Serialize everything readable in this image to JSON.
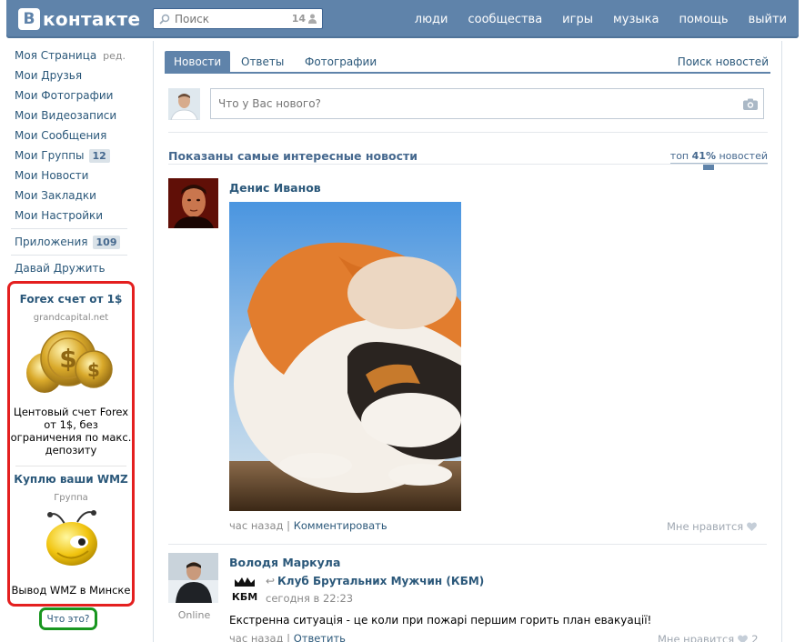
{
  "header": {
    "logo_badge": "В",
    "logo_text": "контакте",
    "search_placeholder": "Поиск",
    "search_count": "14",
    "nav": [
      "люди",
      "сообщества",
      "игры",
      "музыка",
      "помощь",
      "выйти"
    ]
  },
  "sidebar": {
    "items": [
      {
        "label": "Моя Страница",
        "extra": "ред."
      },
      {
        "label": "Мои Друзья"
      },
      {
        "label": "Мои Фотографии"
      },
      {
        "label": "Мои Видеозаписи"
      },
      {
        "label": "Мои Сообщения"
      },
      {
        "label": "Мои Группы",
        "badge": "12"
      },
      {
        "label": "Мои Новости"
      },
      {
        "label": "Мои Закладки"
      },
      {
        "label": "Мои Настройки"
      }
    ],
    "apps": {
      "label": "Приложения",
      "badge": "109"
    },
    "friends_link": "Давай Дружить"
  },
  "ads": [
    {
      "title": "Forex счет от 1$",
      "subtitle": "grandcapital.net",
      "text": "Центовый счет Forex от 1$, без ограничения по макс. депозиту"
    },
    {
      "title": "Куплю ваши WMZ",
      "subtitle": "Группа",
      "text": "Вывод WMZ в Минске"
    }
  ],
  "whatis_label": "Что это?",
  "tabs": {
    "news": "Новости",
    "answers": "Ответы",
    "photos": "Фотографии",
    "search_news": "Поиск новостей"
  },
  "composer": {
    "placeholder": "Что у Вас нового?"
  },
  "feed": {
    "title": "Показаны самые интересные новости",
    "filter_prefix": "топ",
    "filter_value": "41%",
    "filter_suffix": "новостей"
  },
  "posts": [
    {
      "author": "Денис Иванов",
      "time": "час назад",
      "action": "Комментировать",
      "like_label": "Мне нравится"
    },
    {
      "author": "Володя Маркула",
      "status": "Online",
      "repost_group": "Клуб Брутальних Мужчин (КБМ)",
      "repost_time": "сегодня в 22:23",
      "text": "Екстренна ситуація - це коли при пожарі першим горить план евакуації!",
      "time": "час назад",
      "action": "Ответить",
      "like_label": "Мне нравится",
      "like_count": "2"
    }
  ],
  "colors": {
    "brand": "#5f83aa",
    "link": "#2b587a",
    "ad_border": "#e41f1f",
    "whatis_border": "#18961f"
  }
}
